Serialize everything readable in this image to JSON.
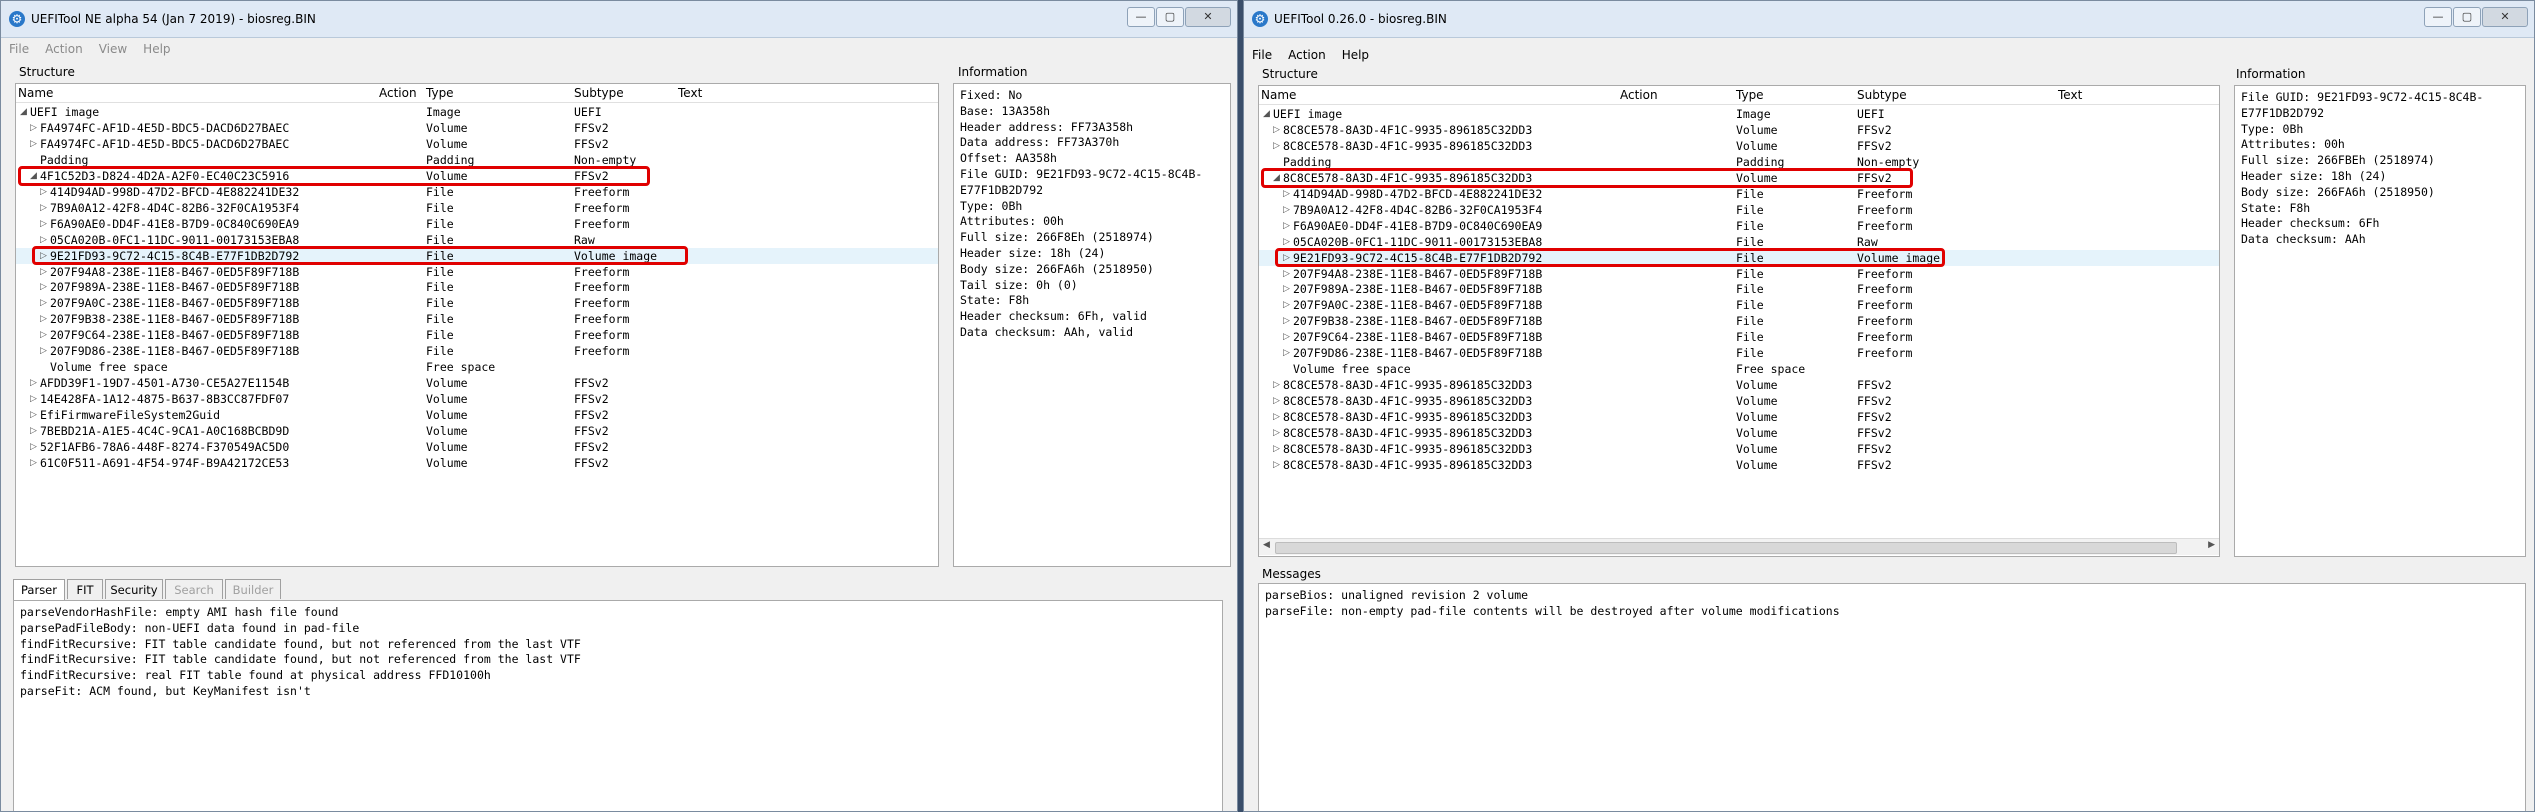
{
  "left": {
    "title": "UEFITool NE alpha 54 (Jan  7 2019) - biosreg.BIN",
    "menu": [
      {
        "label": "File",
        "disabled": true
      },
      {
        "label": "Action",
        "disabled": true
      },
      {
        "label": "View",
        "disabled": true
      },
      {
        "label": "Help",
        "disabled": true
      }
    ],
    "structure_label": "Structure",
    "information_label": "Information",
    "columns": [
      "Name",
      "Action",
      "Type",
      "Subtype",
      "Text"
    ],
    "rows": [
      {
        "indent": 0,
        "exp": "◢",
        "name": "UEFI image",
        "type": "Image",
        "subtype": "UEFI"
      },
      {
        "indent": 1,
        "exp": "▷",
        "name": "FA4974FC-AF1D-4E5D-BDC5-DACD6D27BAEC",
        "type": "Volume",
        "subtype": "FFSv2"
      },
      {
        "indent": 1,
        "exp": "▷",
        "name": "FA4974FC-AF1D-4E5D-BDC5-DACD6D27BAEC",
        "type": "Volume",
        "subtype": "FFSv2"
      },
      {
        "indent": 1,
        "exp": "",
        "name": "Padding",
        "type": "Padding",
        "subtype": "Non-empty"
      },
      {
        "indent": 1,
        "exp": "◢",
        "name": "4F1C52D3-D824-4D2A-A2F0-EC40C23C5916",
        "type": "Volume",
        "subtype": "FFSv2"
      },
      {
        "indent": 2,
        "exp": "▷",
        "name": "414D94AD-998D-47D2-BFCD-4E882241DE32",
        "type": "File",
        "subtype": "Freeform"
      },
      {
        "indent": 2,
        "exp": "▷",
        "name": "7B9A0A12-42F8-4D4C-82B6-32F0CA1953F4",
        "type": "File",
        "subtype": "Freeform"
      },
      {
        "indent": 2,
        "exp": "▷",
        "name": "F6A90AE0-DD4F-41E8-B7D9-0C840C690EA9",
        "type": "File",
        "subtype": "Freeform"
      },
      {
        "indent": 2,
        "exp": "▷",
        "name": "05CA020B-0FC1-11DC-9011-00173153EBA8",
        "type": "File",
        "subtype": "Raw"
      },
      {
        "indent": 2,
        "exp": "▷",
        "name": "9E21FD93-9C72-4C15-8C4B-E77F1DB2D792",
        "type": "File",
        "subtype": "Volume image"
      },
      {
        "indent": 2,
        "exp": "▷",
        "name": "207F94A8-238E-11E8-B467-0ED5F89F718B",
        "type": "File",
        "subtype": "Freeform"
      },
      {
        "indent": 2,
        "exp": "▷",
        "name": "207F989A-238E-11E8-B467-0ED5F89F718B",
        "type": "File",
        "subtype": "Freeform"
      },
      {
        "indent": 2,
        "exp": "▷",
        "name": "207F9A0C-238E-11E8-B467-0ED5F89F718B",
        "type": "File",
        "subtype": "Freeform"
      },
      {
        "indent": 2,
        "exp": "▷",
        "name": "207F9B38-238E-11E8-B467-0ED5F89F718B",
        "type": "File",
        "subtype": "Freeform"
      },
      {
        "indent": 2,
        "exp": "▷",
        "name": "207F9C64-238E-11E8-B467-0ED5F89F718B",
        "type": "File",
        "subtype": "Freeform"
      },
      {
        "indent": 2,
        "exp": "▷",
        "name": "207F9D86-238E-11E8-B467-0ED5F89F718B",
        "type": "File",
        "subtype": "Freeform"
      },
      {
        "indent": 2,
        "exp": "",
        "name": "Volume free space",
        "type": "Free space",
        "subtype": ""
      },
      {
        "indent": 1,
        "exp": "▷",
        "name": "AFDD39F1-19D7-4501-A730-CE5A27E1154B",
        "type": "Volume",
        "subtype": "FFSv2"
      },
      {
        "indent": 1,
        "exp": "▷",
        "name": "14E428FA-1A12-4875-B637-8B3CC87FDF07",
        "type": "Volume",
        "subtype": "FFSv2"
      },
      {
        "indent": 1,
        "exp": "▷",
        "name": "EfiFirmwareFileSystem2Guid",
        "type": "Volume",
        "subtype": "FFSv2"
      },
      {
        "indent": 1,
        "exp": "▷",
        "name": "7BEBD21A-A1E5-4C4C-9CA1-A0C168BCBD9D",
        "type": "Volume",
        "subtype": "FFSv2"
      },
      {
        "indent": 1,
        "exp": "▷",
        "name": "52F1AFB6-78A6-448F-8274-F370549AC5D0",
        "type": "Volume",
        "subtype": "FFSv2"
      },
      {
        "indent": 1,
        "exp": "▷",
        "name": "61C0F511-A691-4F54-974F-B9A42172CE53",
        "type": "Volume",
        "subtype": "FFSv2"
      }
    ],
    "info_text": "Fixed: No\nBase: 13A358h\nHeader address: FF73A358h\nData address: FF73A370h\nOffset: AA358h\nFile GUID: 9E21FD93-9C72-4C15-8C4B-\nE77F1DB2D792\nType: 0Bh\nAttributes: 00h\nFull size: 266F8Eh (2518974)\nHeader size: 18h (24)\nBody size: 266FA6h (2518950)\nTail size: 0h (0)\nState: F8h\nHeader checksum: 6Fh, valid\nData checksum: AAh, valid",
    "tabs": [
      {
        "label": "Parser",
        "active": true,
        "disabled": false
      },
      {
        "label": "FIT",
        "active": false,
        "disabled": false
      },
      {
        "label": "Security",
        "active": false,
        "disabled": false
      },
      {
        "label": "Search",
        "active": false,
        "disabled": true
      },
      {
        "label": "Builder",
        "active": false,
        "disabled": true
      }
    ],
    "messages": "parseVendorHashFile: empty AMI hash file found\nparsePadFileBody: non-UEFI data found in pad-file\nfindFitRecursive: FIT table candidate found, but not referenced from the last VTF\nfindFitRecursive: FIT table candidate found, but not referenced from the last VTF\nfindFitRecursive: real FIT table found at physical address FFD10100h\nparseFit: ACM found, but KeyManifest isn't"
  },
  "right": {
    "title": "UEFITool 0.26.0 - biosreg.BIN",
    "menu": [
      {
        "label": "File",
        "disabled": false
      },
      {
        "label": "Action",
        "disabled": false
      },
      {
        "label": "Help",
        "disabled": false
      }
    ],
    "structure_label": "Structure",
    "information_label": "Information",
    "messages_label": "Messages",
    "columns": [
      "Name",
      "Action",
      "Type",
      "Subtype",
      "Text"
    ],
    "rows": [
      {
        "indent": 0,
        "exp": "◢",
        "name": "UEFI image",
        "type": "Image",
        "subtype": "UEFI"
      },
      {
        "indent": 1,
        "exp": "▷",
        "name": "8C8CE578-8A3D-4F1C-9935-896185C32DD3",
        "type": "Volume",
        "subtype": "FFSv2"
      },
      {
        "indent": 1,
        "exp": "▷",
        "name": "8C8CE578-8A3D-4F1C-9935-896185C32DD3",
        "type": "Volume",
        "subtype": "FFSv2"
      },
      {
        "indent": 1,
        "exp": "",
        "name": "Padding",
        "type": "Padding",
        "subtype": "Non-empty"
      },
      {
        "indent": 1,
        "exp": "◢",
        "name": "8C8CE578-8A3D-4F1C-9935-896185C32DD3",
        "type": "Volume",
        "subtype": "FFSv2"
      },
      {
        "indent": 2,
        "exp": "▷",
        "name": "414D94AD-998D-47D2-BFCD-4E882241DE32",
        "type": "File",
        "subtype": "Freeform"
      },
      {
        "indent": 2,
        "exp": "▷",
        "name": "7B9A0A12-42F8-4D4C-82B6-32F0CA1953F4",
        "type": "File",
        "subtype": "Freeform"
      },
      {
        "indent": 2,
        "exp": "▷",
        "name": "F6A90AE0-DD4F-41E8-B7D9-0C840C690EA9",
        "type": "File",
        "subtype": "Freeform"
      },
      {
        "indent": 2,
        "exp": "▷",
        "name": "05CA020B-0FC1-11DC-9011-00173153EBA8",
        "type": "File",
        "subtype": "Raw"
      },
      {
        "indent": 2,
        "exp": "▷",
        "name": "9E21FD93-9C72-4C15-8C4B-E77F1DB2D792",
        "type": "File",
        "subtype": "Volume image"
      },
      {
        "indent": 2,
        "exp": "▷",
        "name": "207F94A8-238E-11E8-B467-0ED5F89F718B",
        "type": "File",
        "subtype": "Freeform"
      },
      {
        "indent": 2,
        "exp": "▷",
        "name": "207F989A-238E-11E8-B467-0ED5F89F718B",
        "type": "File",
        "subtype": "Freeform"
      },
      {
        "indent": 2,
        "exp": "▷",
        "name": "207F9A0C-238E-11E8-B467-0ED5F89F718B",
        "type": "File",
        "subtype": "Freeform"
      },
      {
        "indent": 2,
        "exp": "▷",
        "name": "207F9B38-238E-11E8-B467-0ED5F89F718B",
        "type": "File",
        "subtype": "Freeform"
      },
      {
        "indent": 2,
        "exp": "▷",
        "name": "207F9C64-238E-11E8-B467-0ED5F89F718B",
        "type": "File",
        "subtype": "Freeform"
      },
      {
        "indent": 2,
        "exp": "▷",
        "name": "207F9D86-238E-11E8-B467-0ED5F89F718B",
        "type": "File",
        "subtype": "Freeform"
      },
      {
        "indent": 2,
        "exp": "",
        "name": "Volume free space",
        "type": "Free space",
        "subtype": ""
      },
      {
        "indent": 1,
        "exp": "▷",
        "name": "8C8CE578-8A3D-4F1C-9935-896185C32DD3",
        "type": "Volume",
        "subtype": "FFSv2"
      },
      {
        "indent": 1,
        "exp": "▷",
        "name": "8C8CE578-8A3D-4F1C-9935-896185C32DD3",
        "type": "Volume",
        "subtype": "FFSv2"
      },
      {
        "indent": 1,
        "exp": "▷",
        "name": "8C8CE578-8A3D-4F1C-9935-896185C32DD3",
        "type": "Volume",
        "subtype": "FFSv2"
      },
      {
        "indent": 1,
        "exp": "▷",
        "name": "8C8CE578-8A3D-4F1C-9935-896185C32DD3",
        "type": "Volume",
        "subtype": "FFSv2"
      },
      {
        "indent": 1,
        "exp": "▷",
        "name": "8C8CE578-8A3D-4F1C-9935-896185C32DD3",
        "type": "Volume",
        "subtype": "FFSv2"
      },
      {
        "indent": 1,
        "exp": "▷",
        "name": "8C8CE578-8A3D-4F1C-9935-896185C32DD3",
        "type": "Volume",
        "subtype": "FFSv2"
      }
    ],
    "info_text": "File GUID: 9E21FD93-9C72-4C15-8C4B-\nE77F1DB2D792\nType: 0Bh\nAttributes: 00h\nFull size: 266FBEh (2518974)\nHeader size: 18h (24)\nBody size: 266FA6h (2518950)\nState: F8h\nHeader checksum: 6Fh\nData checksum: AAh",
    "messages": "parseBios: unaligned revision 2 volume\nparseFile: non-empty pad-file contents will be destroyed after volume modifications"
  },
  "colors": {
    "highlight_box": "#e00000",
    "selected_row": "#e5f3fb",
    "titlebar": "#dfe9f5"
  }
}
